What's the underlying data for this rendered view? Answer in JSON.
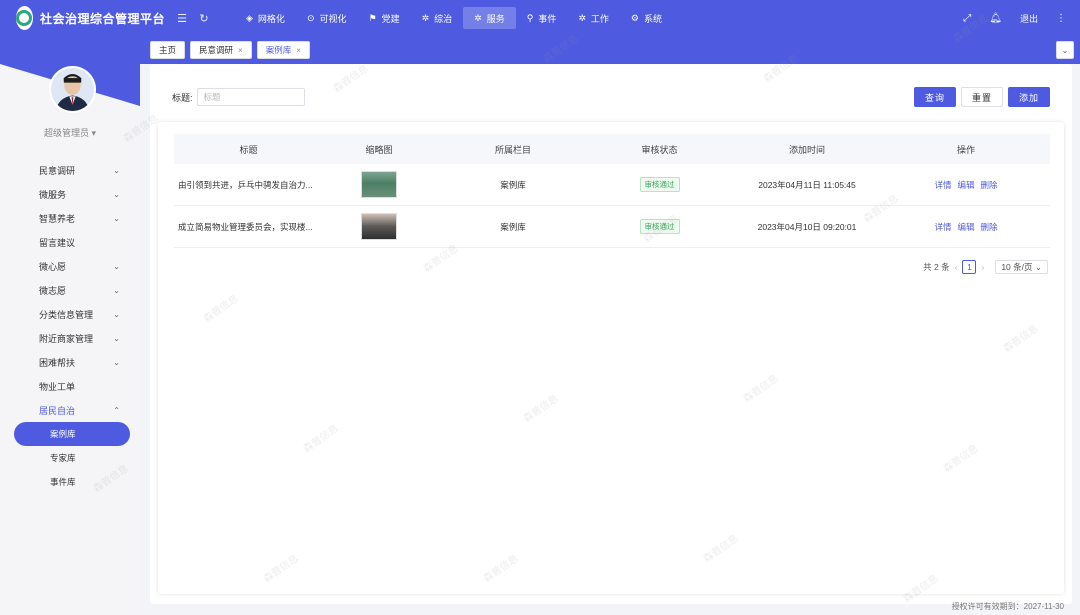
{
  "app": {
    "title": "社会治理综合管理平台"
  },
  "nav": {
    "items": [
      {
        "label": "网格化",
        "icon": "grid-icon"
      },
      {
        "label": "可视化",
        "icon": "eye-icon"
      },
      {
        "label": "党建",
        "icon": "flag-icon"
      },
      {
        "label": "综治",
        "icon": "shield-icon"
      },
      {
        "label": "服务",
        "icon": "service-icon",
        "active": true
      },
      {
        "label": "事件",
        "icon": "pin-icon"
      },
      {
        "label": "工作",
        "icon": "work-icon"
      },
      {
        "label": "系统",
        "icon": "settings-icon"
      }
    ],
    "logout": "退出"
  },
  "sidebar": {
    "user_role": "超级管理员",
    "menu": [
      {
        "label": "民意调研",
        "chev": true
      },
      {
        "label": "微服务",
        "chev": true
      },
      {
        "label": "智慧养老",
        "chev": true
      },
      {
        "label": "留言建议",
        "chev": false
      },
      {
        "label": "微心愿",
        "chev": true
      },
      {
        "label": "微志愿",
        "chev": true
      },
      {
        "label": "分类信息管理",
        "chev": true
      },
      {
        "label": "附近商家管理",
        "chev": true
      },
      {
        "label": "困难帮扶",
        "chev": true
      },
      {
        "label": "物业工单",
        "chev": false
      },
      {
        "label": "居民自治",
        "chev": true,
        "open": true
      }
    ],
    "submenu": [
      {
        "label": "案例库",
        "active": true
      },
      {
        "label": "专家库"
      },
      {
        "label": "事件库"
      }
    ]
  },
  "tabs": [
    {
      "label": "主页",
      "closable": false
    },
    {
      "label": "民意调研",
      "closable": true
    },
    {
      "label": "案例库",
      "closable": true,
      "active": true
    }
  ],
  "search": {
    "label": "标题:",
    "placeholder": "标题",
    "value": ""
  },
  "buttons": {
    "query": "查询",
    "reset": "重置",
    "add": "添加"
  },
  "table": {
    "headers": [
      "标题",
      "缩略图",
      "所属栏目",
      "审核状态",
      "添加时间",
      "操作"
    ],
    "rows": [
      {
        "title": "由引领到共进，乒乓中骋发自治力...",
        "column": "案例库",
        "status": "审核通过",
        "time": "2023年04月11日 11:05:45"
      },
      {
        "title": "成立简易物业管理委员会，实现楼...",
        "column": "案例库",
        "status": "审核通过",
        "time": "2023年04月10日 09:20:01"
      }
    ],
    "actions": [
      "详情",
      "编辑",
      "删除"
    ]
  },
  "pagination": {
    "total": "共 2 条",
    "current": "1",
    "page_size": "10 条/页"
  },
  "footer": {
    "license": "授权许可有效期到：2027-11-30"
  },
  "watermark": "森普信息",
  "colors": {
    "primary": "#4e5be0",
    "success": "#3aa85a"
  }
}
